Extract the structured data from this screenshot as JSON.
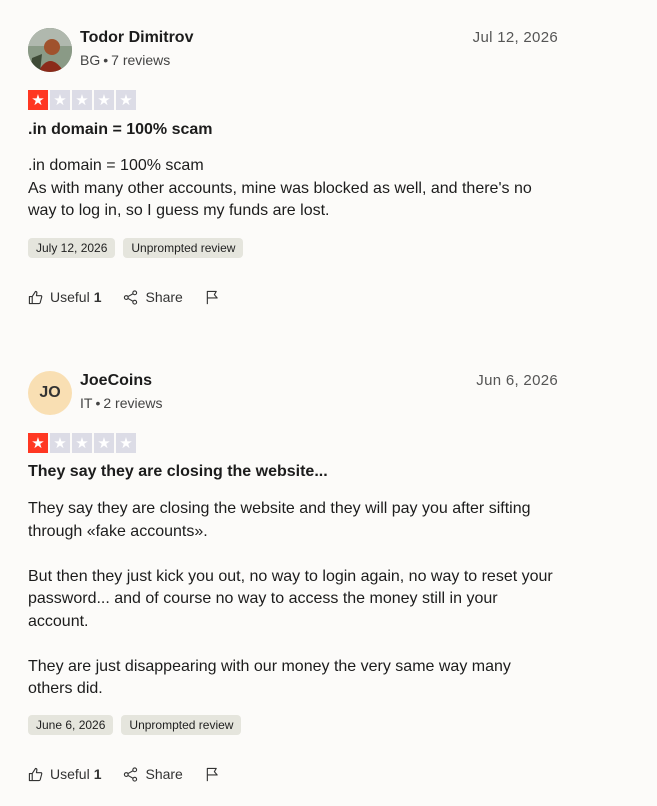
{
  "reviews": [
    {
      "author": "Todor Dimitrov",
      "country": "BG",
      "review_count": "7 reviews",
      "date": "Jul 12, 2026",
      "rating": 1,
      "max_rating": 5,
      "title": ".in domain = 100% scam",
      "body": [
        ".in domain = 100% scam\nAs with many other accounts, mine was blocked as well, and there's no way to log in, so I guess my funds are lost."
      ],
      "experience_date": "July 12, 2026",
      "tag": "Unprompted review",
      "useful_label": "Useful",
      "useful_count": "1",
      "share_label": "Share"
    },
    {
      "author": "JoeCoins",
      "initials": "JO",
      "country": "IT",
      "review_count": "2 reviews",
      "date": "Jun 6, 2026",
      "rating": 1,
      "max_rating": 5,
      "title": "They say they are closing the website...",
      "body": [
        "They say they are closing the website and they will pay you after sifting through «fake accounts».",
        "But then they just kick you out, no way to login again, no way to reset your password... and of course no way to access the money still in your account.",
        "They are just disappearing with our money the very same way many others did."
      ],
      "experience_date": "June 6, 2026",
      "tag": "Unprompted review",
      "useful_label": "Useful",
      "useful_count": "1",
      "share_label": "Share"
    }
  ],
  "colors": {
    "star_filled": "#ff3722",
    "star_empty": "#dcdce6",
    "initials_avatar_bg": "#f9dfb3",
    "page_bg": "#fcfbf9"
  }
}
